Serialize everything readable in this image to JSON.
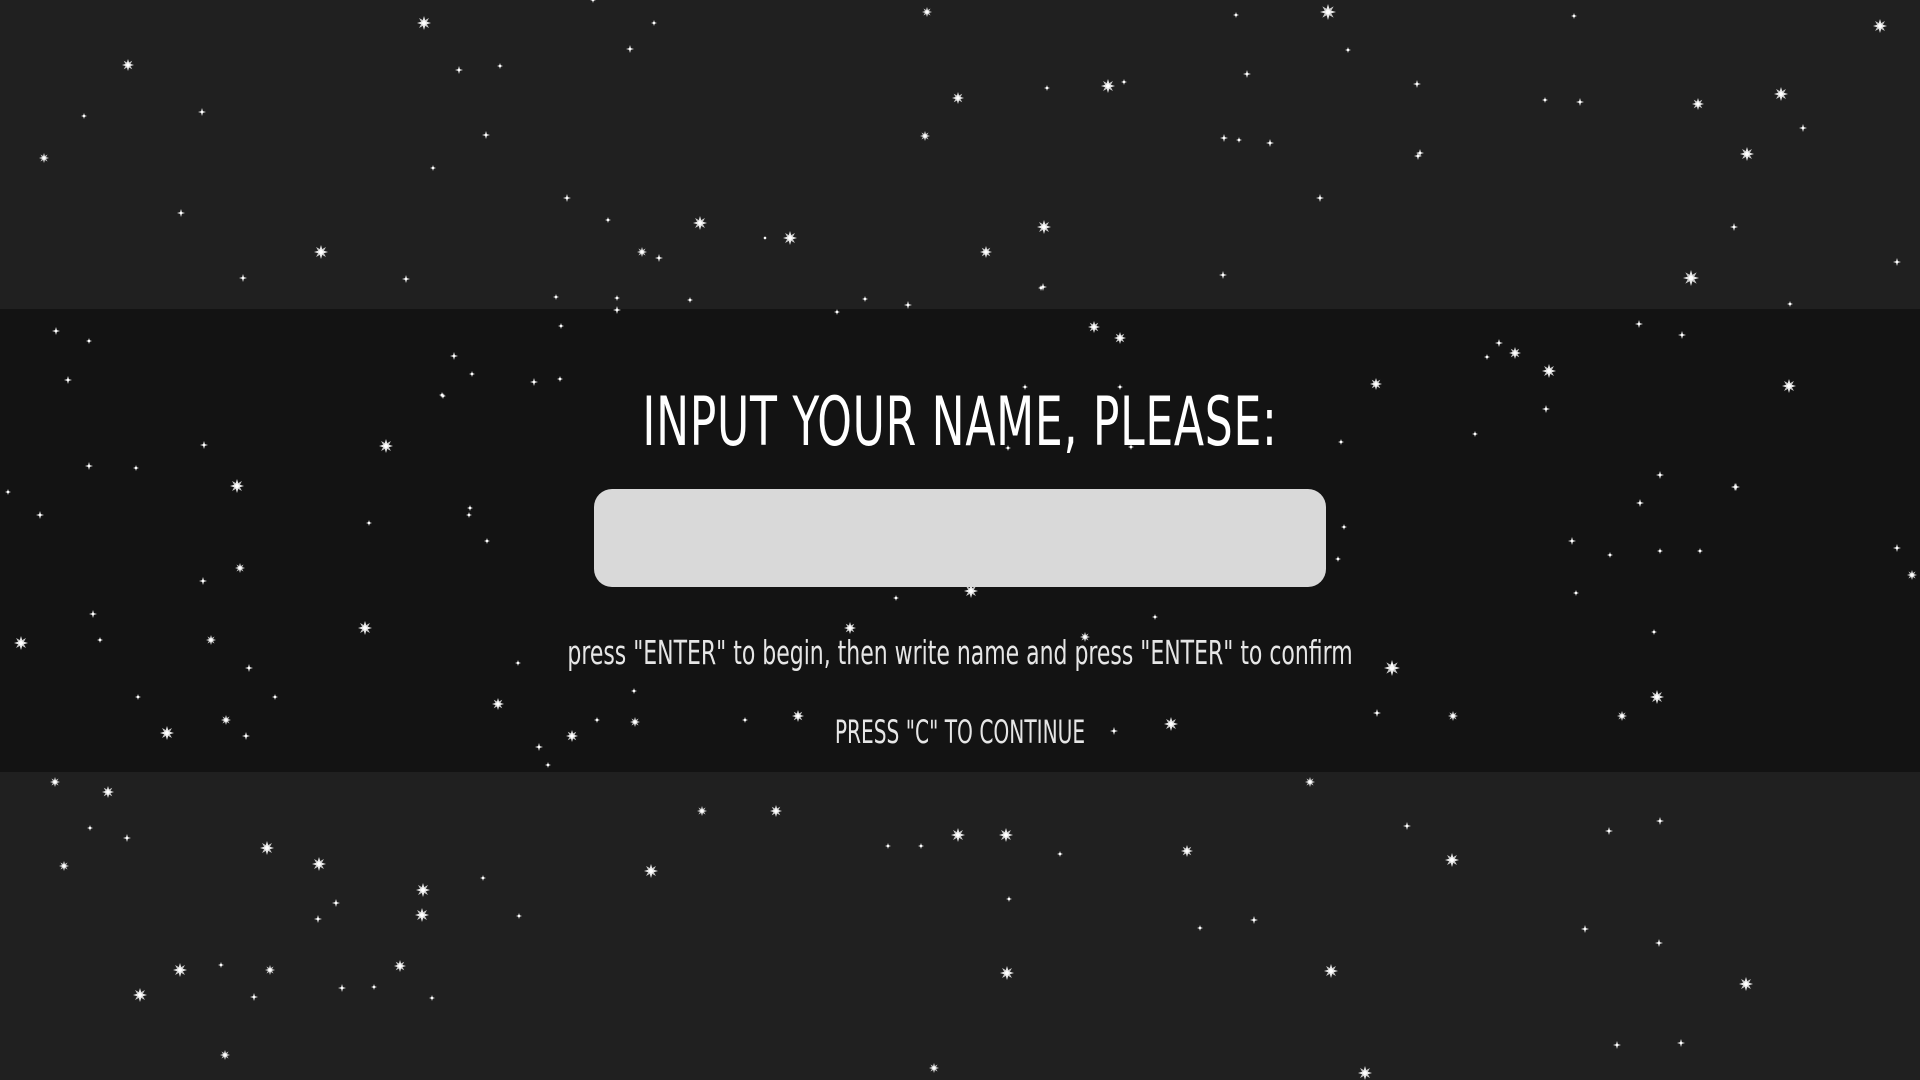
{
  "screen": {
    "title": "INPUT YOUR NAME, PLEASE:",
    "name_input_value": "",
    "hint": "press \"ENTER\" to begin, then write name and press \"ENTER\" to confirm",
    "continue_prompt": "PRESS \"C\" TO CONTINUE"
  },
  "colors": {
    "background": "#202020",
    "band": "#131313",
    "input_fill": "#d9d9d9",
    "text": "#ffffff",
    "star": "#e8e8e8"
  },
  "icons": {
    "star": "sparkle-star-icon"
  }
}
